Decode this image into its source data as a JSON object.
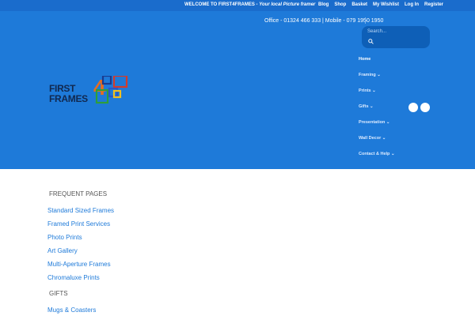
{
  "topbar": {
    "welcome_lead": "WELCOME TO FIRST4FRAMES - ",
    "welcome_tag": "Your local Picture framer",
    "links": [
      "Blog",
      "Shop",
      "Basket",
      "My Wishlist",
      "Log In",
      "Register"
    ]
  },
  "header": {
    "contact": "Office - 01324 466 333 | Mobile - 079 1950 1950",
    "search_placeholder": "Search...",
    "logo": {
      "line1": "FIRST",
      "digit": "4",
      "line2": "FRAMES",
      "colors": {
        "text": "#11284f",
        "digit": "#e76d1f"
      }
    },
    "nav": [
      "Home",
      "Framing ⌄",
      "Prints ⌄",
      "Gifts ⌄",
      "Presentation ⌄",
      "Wall Decor ⌄",
      "Contact & Help ⌄"
    ],
    "social_icons": [
      "social-icon",
      "social-icon"
    ]
  },
  "content": {
    "sections": [
      {
        "title": "FREQUENT PAGES",
        "links": [
          "Standard Sized Frames",
          "Framed Print Services",
          "Photo Prints",
          "Art Gallery",
          "Multi-Aperture Frames",
          "Chromaluxe Prints"
        ]
      },
      {
        "title": "GIFTS",
        "links": [
          "Mugs & Coasters"
        ]
      }
    ]
  },
  "colors": {
    "topbar": "#1a6ccc",
    "header": "#1e7ad9",
    "search_bg": "#0e5fb7",
    "link": "#1e7ad9",
    "section_title": "#555555"
  }
}
